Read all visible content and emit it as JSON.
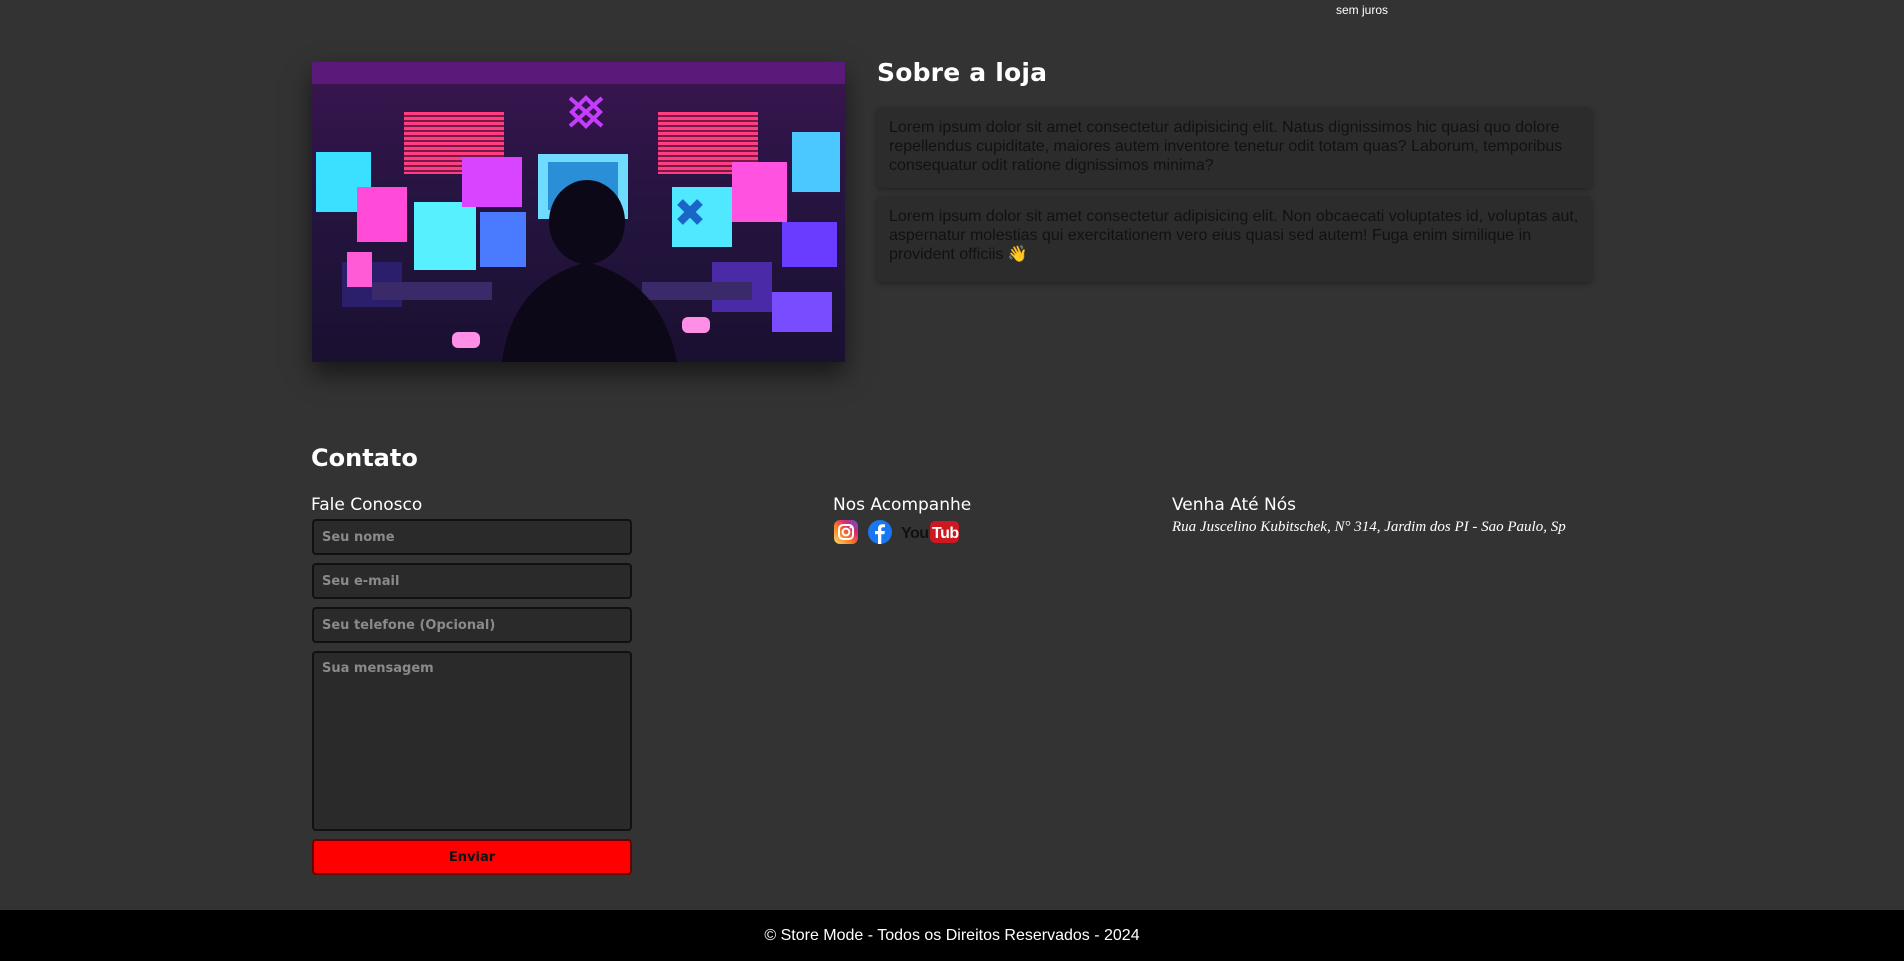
{
  "header": {
    "installment_note": "sem juros"
  },
  "about": {
    "title": "Sobre a loja",
    "image_alt": "pixel-art hacker room",
    "paragraphs": [
      "Lorem ipsum dolor sit amet consectetur adipisicing elit. Natus dignissimos hic quasi quo dolore repellendus cupiditate, maiores autem inventore tenetur odit totam quas? Laborum, temporibus consequatur odit ratione dignissimos minima?",
      "Lorem ipsum dolor sit amet consectetur adipisicing elit. Non obcaecati voluptates id, voluptas aut, aspernatur molestias qui exercitationem vero eius quasi sed autem! Fuga enim similique in provident officiis"
    ],
    "emoji": "👋"
  },
  "contact": {
    "title": "Contato",
    "form": {
      "title": "Fale Conosco",
      "name_placeholder": "Seu nome",
      "email_placeholder": "Seu e-mail",
      "phone_placeholder": "Seu telefone (Opcional)",
      "message_placeholder": "Sua mensagem",
      "submit_label": "Enviar"
    },
    "social": {
      "title": "Nos Acompanhe",
      "icons": [
        "instagram-icon",
        "facebook-icon",
        "youtube-icon"
      ]
    },
    "location": {
      "title": "Venha Até Nós",
      "address": "Rua Juscelino Kubitschek, N° 314, Jardim dos PI - Sao Paulo, Sp"
    }
  },
  "footer": {
    "text": "© Store Mode - Todos os Direitos Reservados - 2024"
  },
  "colors": {
    "page_bg": "#333333",
    "card_bg": "#2c2c2c",
    "accent_red": "#ff0000",
    "footer_bg": "#000000"
  }
}
